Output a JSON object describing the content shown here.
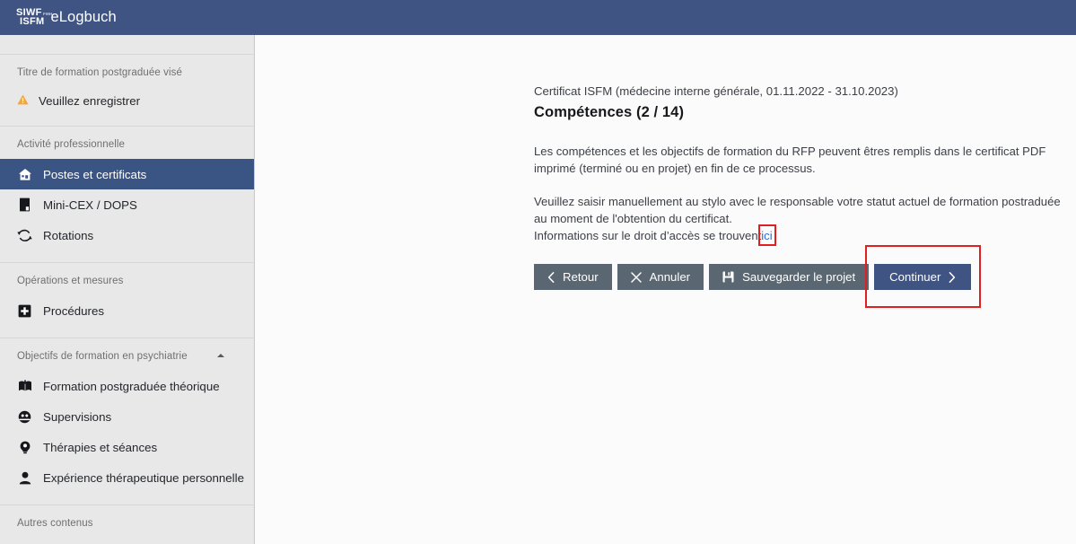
{
  "header": {
    "logo_line1": "SIWF",
    "logo_line2": "ISFM",
    "logo_sup": "FMH",
    "app_name": "eLogbuch"
  },
  "sidebar": {
    "groups": [
      {
        "label": "Titre de formation postgraduée visé",
        "collapsible": false,
        "warning": {
          "icon": "warning-triangle-icon",
          "label": "Veuillez enregistrer"
        },
        "items": []
      },
      {
        "label": "Activité professionnelle",
        "collapsible": false,
        "items": [
          {
            "label": "Postes et certificats",
            "icon": "home-icon",
            "active": true
          },
          {
            "label": "Mini-CEX / DOPS",
            "icon": "clipboard-icon",
            "active": false
          },
          {
            "label": "Rotations",
            "icon": "sync-icon",
            "active": false
          }
        ]
      },
      {
        "label": "Opérations et mesures",
        "collapsible": false,
        "items": [
          {
            "label": "Procédures",
            "icon": "plus-square-icon",
            "active": false
          }
        ]
      },
      {
        "label": "Objectifs de formation en psychiatrie",
        "collapsible": true,
        "items": [
          {
            "label": "Formation postgraduée théorique",
            "icon": "book-icon",
            "active": false
          },
          {
            "label": "Supervisions",
            "icon": "supervision-icon",
            "active": false
          },
          {
            "label": "Thérapies et séances",
            "icon": "therapy-head-icon",
            "active": false
          },
          {
            "label": "Expérience thérapeutique personnelle",
            "icon": "person-icon",
            "active": false
          }
        ]
      },
      {
        "label": "Autres contenus",
        "collapsible": false,
        "items": []
      }
    ]
  },
  "main": {
    "breadcrumb": "Certificat ISFM (médecine interne générale, 01.11.2022 - 31.10.2023)",
    "title": "Compétences (2 / 14)",
    "paragraph1": "Les compétences et les objectifs de formation du RFP peuvent êtres remplis dans le certificat PDF imprimé (terminé ou en projet) en fin de ce processus.",
    "paragraph2_line1": "Veuillez saisir manuellement au stylo avec le responsable votre statut actuel de formation postraduée au moment de l'obtention du certificat.",
    "paragraph2_line2_prefix": "Informations sur le droit d’accès se trouvent",
    "paragraph2_link": "ici",
    "buttons": [
      {
        "label": "Retour",
        "icon": "chevron-left-icon",
        "style": "secondary",
        "highlighted": false
      },
      {
        "label": "Annuler",
        "icon": "close-x-icon",
        "style": "secondary",
        "highlighted": false
      },
      {
        "label": "Sauvegarder le projet",
        "icon": "save-disk-icon",
        "style": "secondary",
        "highlighted": false
      },
      {
        "label": "Continuer",
        "icon": "chevron-right-icon",
        "style": "primary",
        "highlighted": true
      }
    ]
  },
  "colors": {
    "brand_blue": "#3f5483",
    "sidebar_bg": "#e8e8e8",
    "button_gray": "#5a6772",
    "link_blue": "#2f6fd0",
    "highlight_red": "#e02020",
    "warning_orange": "#f2a73b"
  }
}
